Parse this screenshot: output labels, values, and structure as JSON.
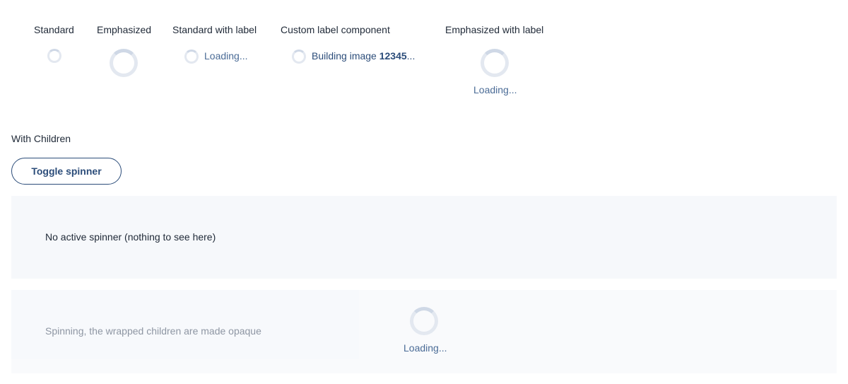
{
  "variants": {
    "standard": {
      "title": "Standard"
    },
    "emphasized": {
      "title": "Emphasized"
    },
    "standard_with_label": {
      "title": "Standard with label",
      "label": "Loading..."
    },
    "custom_label": {
      "title": "Custom label component",
      "label_prefix": "Building image ",
      "label_bold": "12345",
      "label_suffix": "..."
    },
    "emphasized_with_label": {
      "title": "Emphasized with label",
      "label": "Loading..."
    }
  },
  "with_children": {
    "title": "With Children",
    "toggle_label": "Toggle spinner",
    "inactive_text": "No active spinner (nothing to see here)",
    "active_text": "Spinning, the wrapped children are made opaque",
    "active_label": "Loading..."
  },
  "colors": {
    "accent": "#2c4d7a",
    "label": "#4a6b96",
    "panel_bg": "#f6f8fb",
    "spinner_track": "#e3e8f0"
  }
}
